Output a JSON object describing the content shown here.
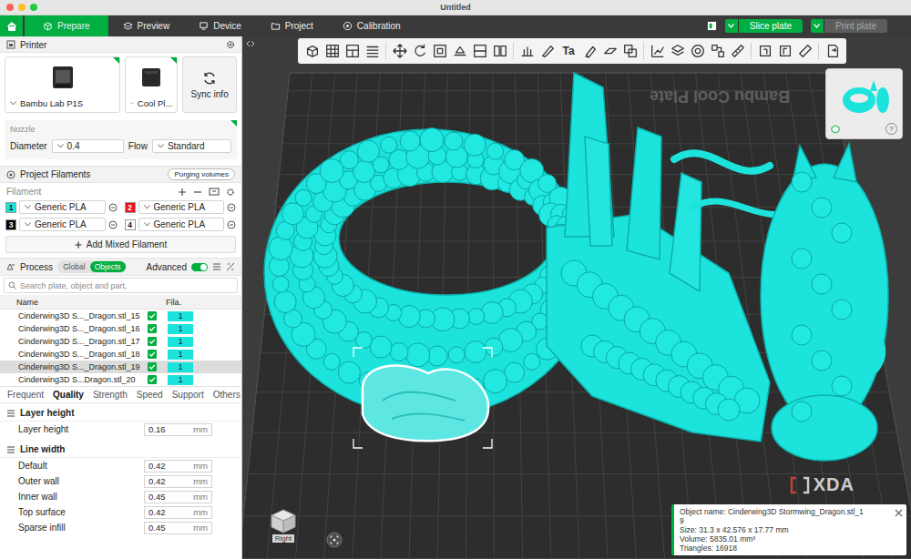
{
  "window": {
    "title": "Untitled"
  },
  "nav": {
    "tabs": [
      {
        "label": "Prepare",
        "selected": true
      },
      {
        "label": "Preview",
        "selected": false
      },
      {
        "label": "Device",
        "selected": false
      },
      {
        "label": "Project",
        "selected": false
      },
      {
        "label": "Calibration",
        "selected": false
      }
    ],
    "slice_button": {
      "label": "Slice plate",
      "disabled": false
    },
    "print_button": {
      "label": "Print plate",
      "disabled": true
    }
  },
  "printer": {
    "header": "Printer",
    "printer_name": "Bambu Lab P1S",
    "plate_name": "Cool Pl...",
    "sync_label": "Sync info",
    "nozzle_label": "Nozzle",
    "diameter_label": "Diameter",
    "diameter": "0.4",
    "flow_label": "Flow",
    "flow": "Standard"
  },
  "filaments": {
    "header": "Project Filaments",
    "purging": "Purging volumes",
    "label": "Filament",
    "items": [
      {
        "index": "1",
        "name": "Generic PLA",
        "color": "#1de3dd"
      },
      {
        "index": "2",
        "name": "Generic PLA",
        "color": "#e8141a"
      },
      {
        "index": "3",
        "name": "Generic PLA",
        "color": "#000000"
      },
      {
        "index": "4",
        "name": "Generic PLA",
        "color": "#ffffff"
      }
    ],
    "add_mixed": "Add Mixed Filament"
  },
  "process": {
    "header": "Process",
    "scope": [
      {
        "label": "Global",
        "selected": false
      },
      {
        "label": "Objects",
        "selected": true
      }
    ],
    "advanced_label": "Advanced",
    "advanced": true,
    "search_placeholder": "Search plate, object and part.",
    "columns": [
      "Name",
      "Fila."
    ],
    "objects": [
      {
        "name": "Cinderwing3D S..._Dragon.stl_15",
        "checked": true,
        "filament": "1",
        "selected": false
      },
      {
        "name": "Cinderwing3D S..._Dragon.stl_16",
        "checked": true,
        "filament": "1",
        "selected": false
      },
      {
        "name": "Cinderwing3D S..._Dragon.stl_17",
        "checked": true,
        "filament": "1",
        "selected": false
      },
      {
        "name": "Cinderwing3D S..._Dragon.stl_18",
        "checked": true,
        "filament": "1",
        "selected": false
      },
      {
        "name": "Cinderwing3D S..._Dragon.stl_19",
        "checked": true,
        "filament": "1",
        "selected": true
      },
      {
        "name": "Cinderwing3D S...Dragon.stl_20",
        "checked": true,
        "filament": "1",
        "selected": false
      }
    ]
  },
  "settings_tabs": [
    {
      "label": "Frequent",
      "selected": false
    },
    {
      "label": "Quality",
      "selected": true
    },
    {
      "label": "Strength",
      "selected": false
    },
    {
      "label": "Speed",
      "selected": false
    },
    {
      "label": "Support",
      "selected": false
    },
    {
      "label": "Others",
      "selected": false
    }
  ],
  "sections": [
    {
      "title": "Layer height",
      "rows": [
        {
          "label": "Layer height",
          "value": "0.16",
          "unit": "mm"
        }
      ]
    },
    {
      "title": "Line width",
      "rows": [
        {
          "label": "Default",
          "value": "0.42",
          "unit": "mm"
        },
        {
          "label": "Outer wall",
          "value": "0.42",
          "unit": "mm"
        },
        {
          "label": "Inner wall",
          "value": "0.45",
          "unit": "mm"
        },
        {
          "label": "Top surface",
          "value": "0.42",
          "unit": "mm"
        },
        {
          "label": "Sparse infill",
          "value": "0.45",
          "unit": "mm"
        }
      ]
    }
  ],
  "canvas": {
    "plate_label": "Bambu Cool Plate",
    "text_tool_glyph": "Ta",
    "view_cube_label": "Right",
    "thumbnail_help": "?",
    "watermark": "XDA"
  },
  "object_info": {
    "lines": [
      "Object name: Cinderwing3D Stormwing_Dragon.stl_1",
      "9",
      "Size: 31.3 x 42.576 x 17.77 mm",
      "Volume: 5835.01 mm³",
      "Triangles: 16918"
    ]
  }
}
